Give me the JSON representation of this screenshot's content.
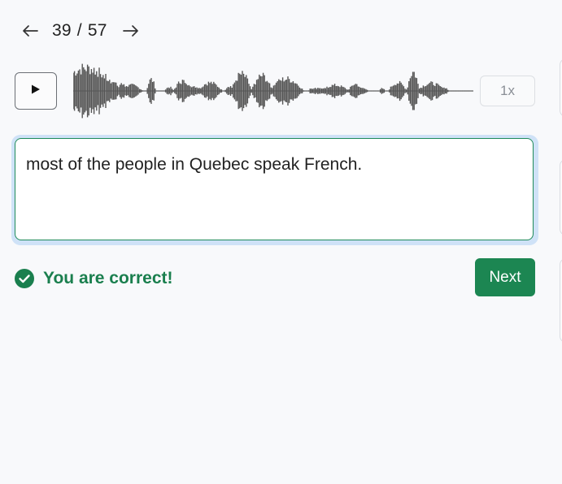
{
  "pager": {
    "current": "39",
    "separator": "/",
    "total": "57",
    "prev_icon": "arrow-left-icon",
    "next_icon": "arrow-right-icon"
  },
  "player": {
    "play_icon": "play-icon",
    "speed_label": "1x"
  },
  "answer": {
    "value": "most of the people in Quebec speak French."
  },
  "feedback": {
    "icon": "check-circle-icon",
    "message": "You are correct!"
  },
  "actions": {
    "next_label": "Next"
  },
  "colors": {
    "success": "#1a7f4e",
    "primary_button": "#1c8652",
    "focus_ring": "#cfe2f7",
    "waveform": "#555555"
  }
}
